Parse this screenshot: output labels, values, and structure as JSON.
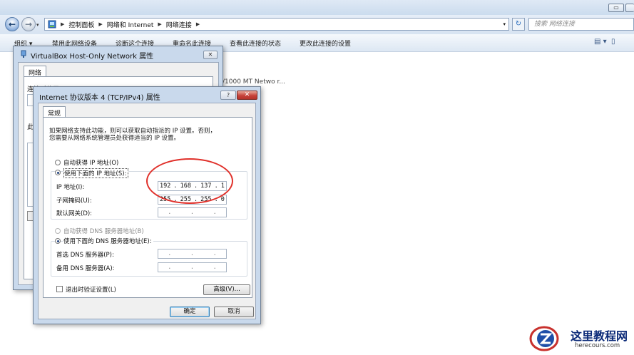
{
  "explorer": {
    "breadcrumbs": [
      "控制面板",
      "网络和 Internet",
      "网络连接"
    ],
    "search_placeholder": "搜索 网络连接",
    "commands": [
      "组织 ▾",
      "禁用此网络设备",
      "诊断这个连接",
      "重命名此连接",
      "查看此连接的状态",
      "更改此连接的设置"
    ],
    "device_text": "/1000 MT Netwo r...",
    "icons": {
      "back": "back-arrow-icon",
      "forward": "forward-arrow-icon",
      "refresh": "refresh-icon",
      "view": "view-options-icon",
      "control_panel": "control-panel-icon"
    }
  },
  "vbox_dialog": {
    "title": "VirtualBox Host-Only Network 属性",
    "tab": "网络",
    "connect_using_label": "连接时使用:",
    "fragment_char": "此"
  },
  "ipv4_dialog": {
    "title": "Internet 协议版本 4 (TCP/IPv4) 属性",
    "tab": "常规",
    "intro_line1": "如果网络支持此功能，则可以获取自动指派的 IP 设置。否则，",
    "intro_line2": "您需要从网络系统管理员处获得适当的 IP 设置。",
    "ip_auto": "自动获得 IP 地址(O)",
    "ip_manual": "使用下面的 IP 地址(S):",
    "ip_label": "IP 地址(I):",
    "ip_octets": [
      "192",
      "168",
      "137",
      "1"
    ],
    "mask_label": "子网掩码(U):",
    "mask_octets": [
      "255",
      "255",
      "255",
      "0"
    ],
    "gateway_label": "默认网关(D):",
    "dns_auto": "自动获得 DNS 服务器地址(B)",
    "dns_manual": "使用下面的 DNS 服务器地址(E):",
    "dns_pref_label": "首选 DNS 服务器(P):",
    "dns_alt_label": "备用 DNS 服务器(A):",
    "validate_label": "退出时验证设置(L)",
    "advanced_btn": "高级(V)...",
    "ok_btn": "确定",
    "cancel_btn": "取消",
    "help_btn": "?",
    "close_btn": "✕"
  },
  "watermark": {
    "title": "这里教程网",
    "url": "herecours.com"
  },
  "colors": {
    "annotation_red": "#e0302a",
    "title_bar": "#c9d9ec",
    "close_red": "#c6423a",
    "watermark_blue": "#0b2a78"
  }
}
